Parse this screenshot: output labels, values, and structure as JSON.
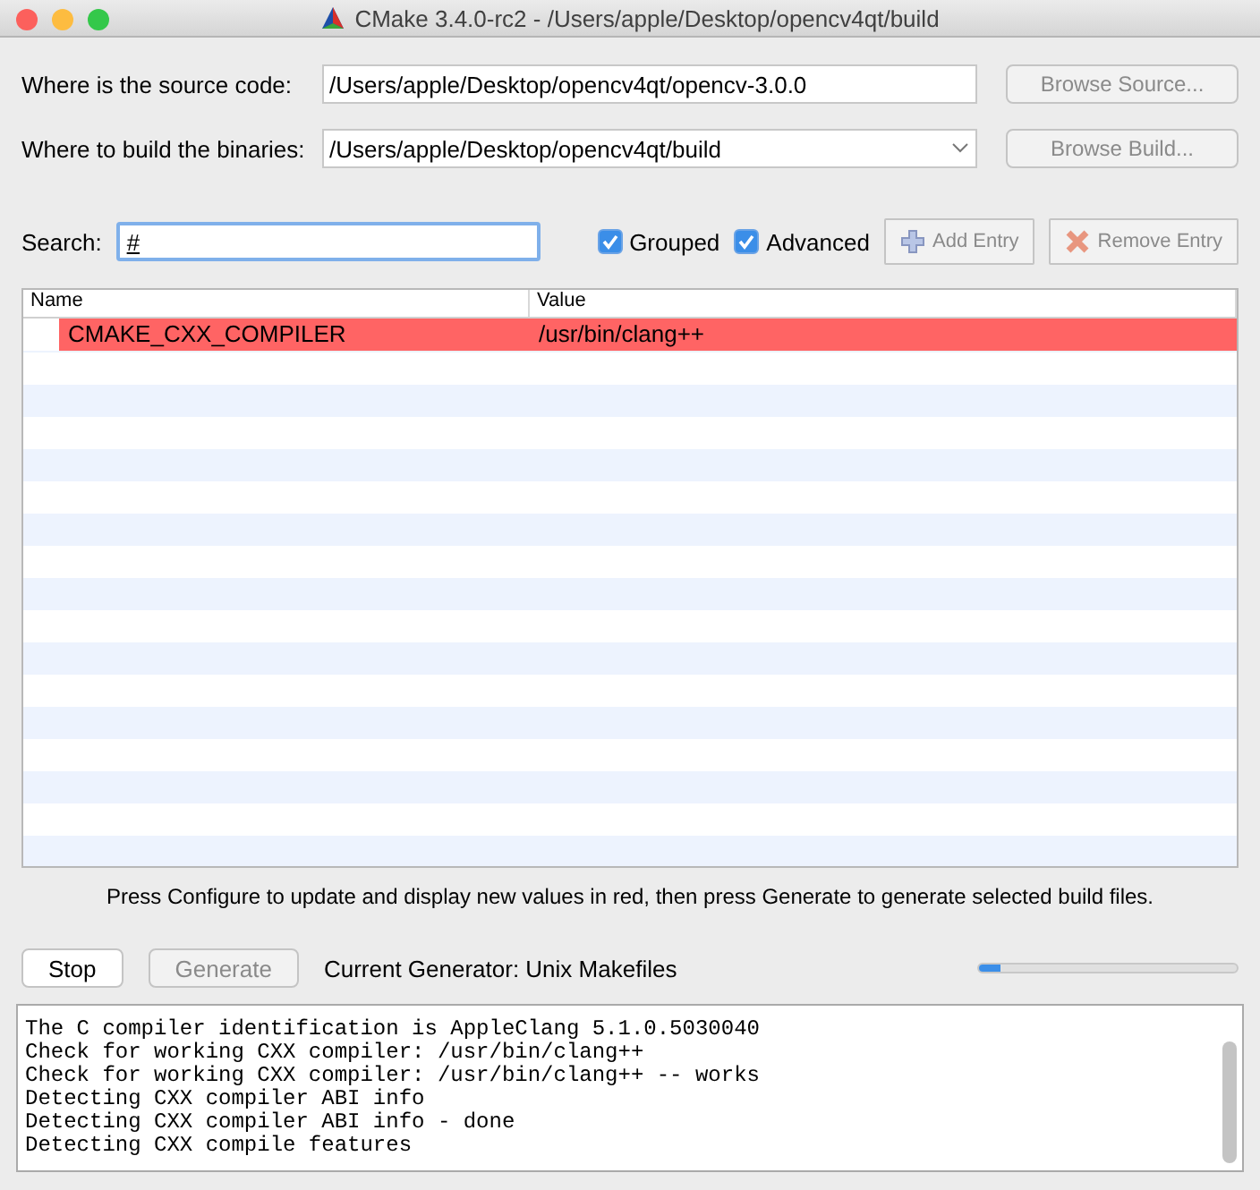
{
  "window": {
    "title": "CMake 3.4.0-rc2 - /Users/apple/Desktop/opencv4qt/build"
  },
  "source": {
    "label": "Where is the source code:",
    "value": "/Users/apple/Desktop/opencv4qt/opencv-3.0.0",
    "button": {
      "label": "Browse Source...",
      "disabled": true
    }
  },
  "build": {
    "label": "Where to build the binaries:",
    "value": "/Users/apple/Desktop/opencv4qt/build",
    "button": {
      "label": "Browse Build...",
      "disabled": true
    }
  },
  "search": {
    "label": "Search:",
    "value": "#"
  },
  "options": [
    {
      "label": "Grouped",
      "checked": true
    },
    {
      "label": "Advanced",
      "checked": true
    }
  ],
  "entry_buttons": [
    {
      "label": "Add Entry",
      "kind": "add",
      "disabled": true
    },
    {
      "label": "Remove Entry",
      "kind": "remove",
      "disabled": true
    }
  ],
  "table": {
    "columns": [
      "Name",
      "Value"
    ],
    "rows": [
      {
        "name": "CMAKE_CXX_COMPILER",
        "value": "/usr/bin/clang++",
        "new": true
      }
    ]
  },
  "hint": "Press Configure to update and display new values in red, then press Generate to generate selected build files.",
  "actions": [
    {
      "label": "Stop",
      "disabled": false
    },
    {
      "label": "Generate",
      "disabled": true
    }
  ],
  "generator": "Current Generator: Unix Makefiles",
  "progress": {
    "level": 0.08
  },
  "log": [
    "The C compiler identification is AppleClang 5.1.0.5030040",
    "Check for working CXX compiler: /usr/bin/clang++",
    "Check for working CXX compiler: /usr/bin/clang++ -- works",
    "Detecting CXX compiler ABI info",
    "Detecting CXX compiler ABI info - done",
    "Detecting CXX compile features"
  ]
}
